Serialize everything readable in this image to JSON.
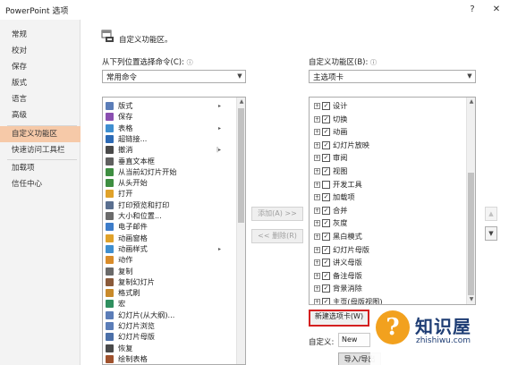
{
  "window": {
    "title": "PowerPoint 选项",
    "help": "?",
    "close": "✕"
  },
  "sidebar": {
    "items": [
      {
        "label": "常规"
      },
      {
        "label": "校对"
      },
      {
        "label": "保存"
      },
      {
        "label": "版式"
      },
      {
        "label": "语言"
      },
      {
        "label": "高级"
      },
      {
        "label": "自定义功能区",
        "active": true
      },
      {
        "label": "快速访问工具栏"
      },
      {
        "label": "加载项"
      },
      {
        "label": "信任中心"
      }
    ]
  },
  "header": {
    "title": "自定义功能区。"
  },
  "left": {
    "label": "从下列位置选择命令(C):",
    "info": "ⓘ",
    "select_value": "常用命令",
    "commands": [
      {
        "label": "版式",
        "icon": "layout-icon",
        "submenu": "▸"
      },
      {
        "label": "保存",
        "icon": "save-icon"
      },
      {
        "label": "表格",
        "icon": "table-icon",
        "submenu": "▸"
      },
      {
        "label": "超链接...",
        "icon": "hyperlink-icon"
      },
      {
        "label": "撤消",
        "icon": "undo-icon",
        "submenu": "|▸"
      },
      {
        "label": "垂直文本框",
        "icon": "vertical-textbox-icon"
      },
      {
        "label": "从当前幻灯片开始",
        "icon": "play-current-icon"
      },
      {
        "label": "从头开始",
        "icon": "play-start-icon"
      },
      {
        "label": "打开",
        "icon": "open-folder-icon"
      },
      {
        "label": "打印预览和打印",
        "icon": "print-preview-icon"
      },
      {
        "label": "大小和位置...",
        "icon": "size-position-icon"
      },
      {
        "label": "电子邮件",
        "icon": "email-icon"
      },
      {
        "label": "动画窗格",
        "icon": "animation-pane-icon"
      },
      {
        "label": "动画样式",
        "icon": "animation-style-icon",
        "submenu": "▸"
      },
      {
        "label": "动作",
        "icon": "action-icon"
      },
      {
        "label": "复制",
        "icon": "copy-icon"
      },
      {
        "label": "复制幻灯片",
        "icon": "duplicate-slide-icon"
      },
      {
        "label": "格式刷",
        "icon": "format-painter-icon"
      },
      {
        "label": "宏",
        "icon": "macro-icon"
      },
      {
        "label": "幻灯片(从大纲)...",
        "icon": "slides-outline-icon"
      },
      {
        "label": "幻灯片浏览",
        "icon": "slide-sorter-icon"
      },
      {
        "label": "幻灯片母版",
        "icon": "slide-master-icon"
      },
      {
        "label": "恢复",
        "icon": "redo-icon"
      },
      {
        "label": "绘制表格",
        "icon": "draw-table-icon"
      }
    ]
  },
  "middle": {
    "add": "添加(A) >>",
    "remove": "<< 删除(R)"
  },
  "right": {
    "label": "自定义功能区(B):",
    "info": "ⓘ",
    "select_value": "主选项卡",
    "tabs": [
      {
        "label": "设计",
        "checked": true
      },
      {
        "label": "切换",
        "checked": true
      },
      {
        "label": "动画",
        "checked": true
      },
      {
        "label": "幻灯片放映",
        "checked": true
      },
      {
        "label": "审阅",
        "checked": true
      },
      {
        "label": "视图",
        "checked": true
      },
      {
        "label": "开发工具",
        "checked": false
      },
      {
        "label": "加载项",
        "checked": true
      },
      {
        "label": "合并",
        "checked": true
      },
      {
        "label": "灰度",
        "checked": true
      },
      {
        "label": "黑白模式",
        "checked": true
      },
      {
        "label": "幻灯片母版",
        "checked": true
      },
      {
        "label": "讲义母版",
        "checked": true
      },
      {
        "label": "备注母版",
        "checked": true
      },
      {
        "label": "背景消除",
        "checked": true
      },
      {
        "label": "主页(母版视图)",
        "checked": true
      }
    ],
    "new_tab": "新建选项卡(W)",
    "customize_label": "自定义:",
    "new_partial": "New",
    "import_export": "导入/导出",
    "move_up": "▲",
    "move_down": "▼"
  },
  "watermark": {
    "badge": "?",
    "brand": "知识屋",
    "domain": "zhishiwu.com"
  },
  "colors": {
    "active_nav": "#f6c9a8",
    "highlight_border": "#d42020",
    "watermark_orange": "#f2a11e",
    "watermark_blue": "#1e3d74"
  }
}
